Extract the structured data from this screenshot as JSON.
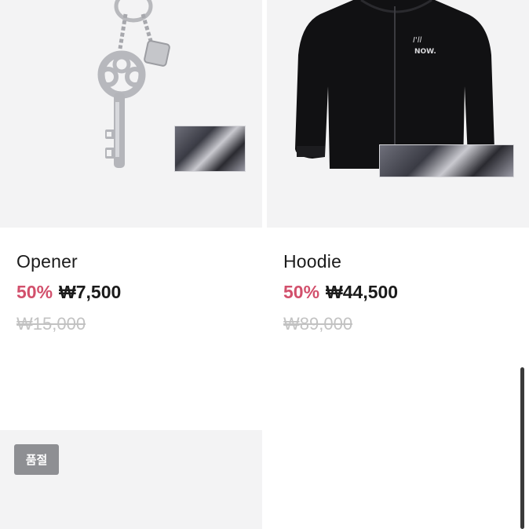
{
  "products": [
    {
      "name": "Opener",
      "discount": "50%",
      "price": "₩7,500",
      "original_price": "₩15,000"
    },
    {
      "name": "Hoodie",
      "discount": "50%",
      "price": "₩44,500",
      "original_price": "₩89,000"
    }
  ],
  "sold_out_label": "품절",
  "colors": {
    "discount": "#d2506c",
    "thumb_bg": "#f3f3f4",
    "badge_bg": "#8e8f93"
  }
}
